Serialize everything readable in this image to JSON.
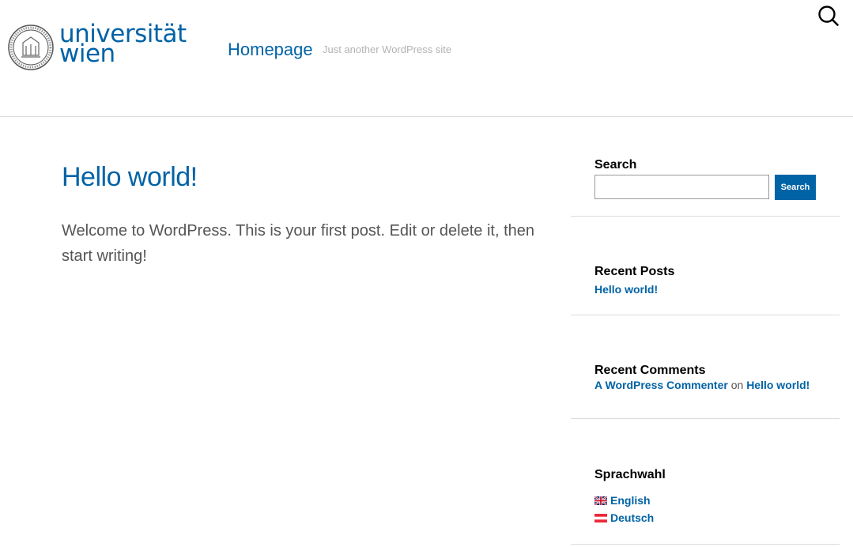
{
  "header": {
    "logo": {
      "line1": "universität",
      "line2": "wien"
    },
    "site_title": "Homepage",
    "tagline": "Just another WordPress site",
    "search_icon": "search-icon"
  },
  "post": {
    "title": "Hello world!",
    "content": "Welcome to WordPress. This is your first post. Edit or delete it, then start writing!"
  },
  "sidebar": {
    "search": {
      "title": "Search",
      "input_value": "",
      "button_label": "Search"
    },
    "recent_posts": {
      "title": "Recent Posts",
      "items": [
        "Hello world!"
      ]
    },
    "recent_comments": {
      "title": "Recent Comments",
      "author": "A WordPress Commenter",
      "on": "on",
      "post": "Hello world!"
    },
    "language": {
      "title": "Sprachwahl",
      "items": [
        "English",
        "Deutsch"
      ]
    }
  },
  "colors": {
    "accent": "#0063a6",
    "tagline": "#b3b3b3",
    "divider": "#dcdcdc"
  }
}
